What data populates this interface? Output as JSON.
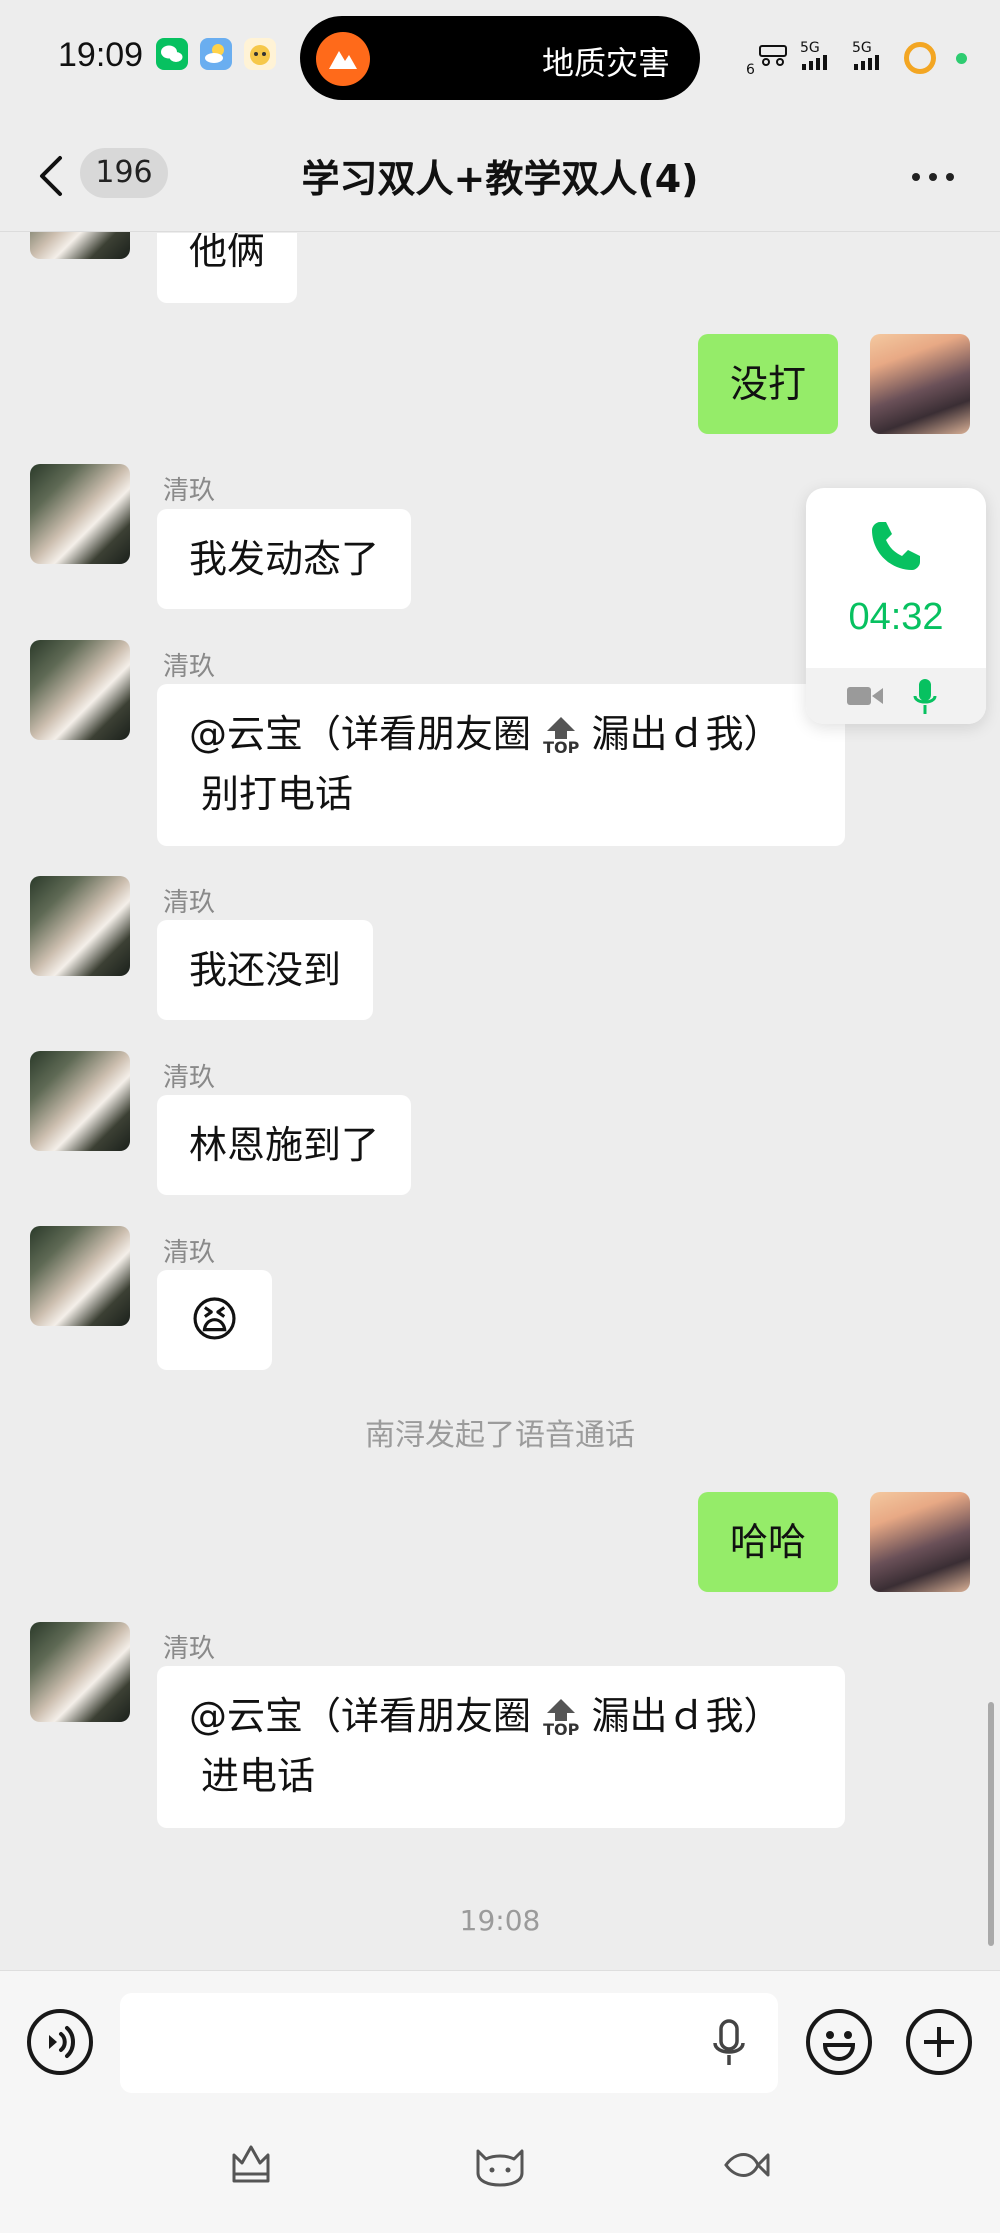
{
  "status_bar": {
    "time": "19:09",
    "island_text": "地质灾害",
    "signal_1": "5G",
    "signal_2": "5G",
    "signal_small": "6",
    "icons": [
      "wechat-icon",
      "weather-icon",
      "cat-app-icon",
      "alert-icon",
      "charging-ring-icon"
    ]
  },
  "nav": {
    "unread": "196",
    "title": "学习双人+教学双人(4)"
  },
  "messages": [
    {
      "sender": "",
      "text": "他俩",
      "side": "left"
    },
    {
      "sender": "",
      "text": "没打",
      "side": "right"
    },
    {
      "sender": "清玖",
      "text": "我发动态了",
      "side": "left"
    },
    {
      "sender": "清玖",
      "text_line1_a": "@云宝（详看朋友圈",
      "text_line1_b": "漏出ｄ我）",
      "text_line2": "别打电话",
      "top_badge": "TOP",
      "side": "left"
    },
    {
      "sender": "清玖",
      "text": "我还没到",
      "side": "left"
    },
    {
      "sender": "清玖",
      "text": "林恩施到了",
      "side": "left"
    },
    {
      "sender": "清玖",
      "text": "😫",
      "side": "left"
    },
    {
      "sender": "",
      "text": "哈哈",
      "side": "right"
    },
    {
      "sender": "清玖",
      "text_line1_a": "@云宝（详看朋友圈",
      "text_line1_b": "漏出ｄ我）",
      "text_line2": "进电话",
      "top_badge": "TOP",
      "side": "left"
    }
  ],
  "system_notice": "南浔发起了语音通话",
  "timestamp": "19:08",
  "call_widget": {
    "duration": "04:32"
  },
  "colors": {
    "accent_green": "#07c160",
    "bubble_green": "#95ec69",
    "background": "#ededed"
  }
}
